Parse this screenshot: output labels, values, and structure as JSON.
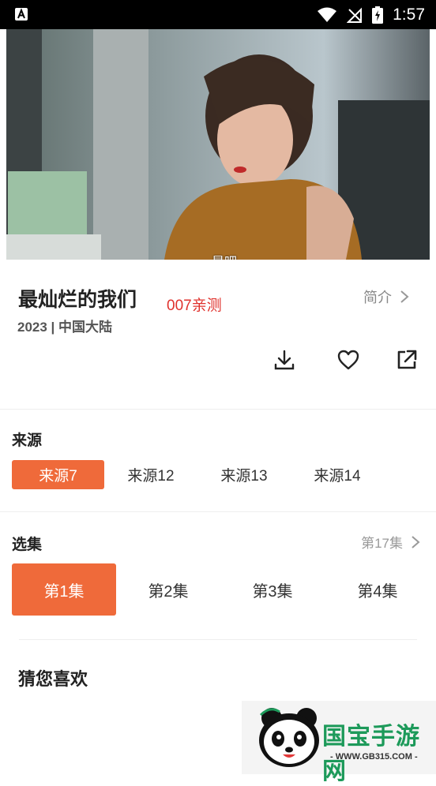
{
  "status_bar": {
    "time": "1:57"
  },
  "video": {
    "subtitle": "是吧"
  },
  "info": {
    "title": "最灿烂的我们",
    "badge": "007亲测",
    "meta": "2023 | 中国大陆",
    "intro_label": "简介"
  },
  "actions": {
    "download": "download-icon",
    "favorite": "heart-icon",
    "share": "share-icon"
  },
  "sources": {
    "title": "来源",
    "items": [
      "来源7",
      "来源12",
      "来源13",
      "来源14"
    ],
    "selected": 0
  },
  "episodes": {
    "title": "选集",
    "total": "第17集",
    "items": [
      "第1集",
      "第2集",
      "第3集",
      "第4集"
    ],
    "selected": 0
  },
  "recommend": {
    "title": "猜您喜欢"
  },
  "watermark": {
    "brand": "国宝手游网",
    "url": "- WWW.GB315.COM -"
  },
  "colors": {
    "accent": "#ef6a3a",
    "badge": "#e0322d",
    "watermark_green": "#1d9a5a"
  }
}
